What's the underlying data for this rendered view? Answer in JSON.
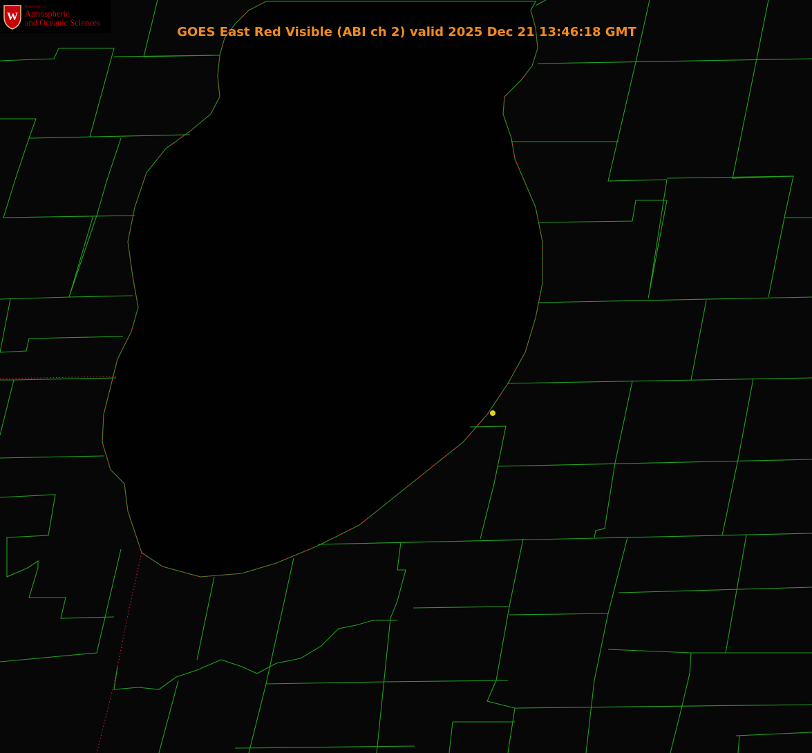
{
  "title": "GOES East Red Visible (ABI ch 2) valid 2025 Dec 21 13:46:18 GMT",
  "logo": {
    "crest_letter": "W",
    "department": "Department of",
    "line1": "Atmospheric",
    "line2": "and Oceanic Sciences"
  },
  "colors": {
    "county_borders": "#1fa21f",
    "shoreline_dots": "#d4202a",
    "title_text": "#f08c1e",
    "logo_red": "#c5050c",
    "marker": "#d9d91e",
    "background": "#070707"
  },
  "map": {
    "features": [
      "lake",
      "county-borders",
      "state-border",
      "location-marker"
    ]
  }
}
